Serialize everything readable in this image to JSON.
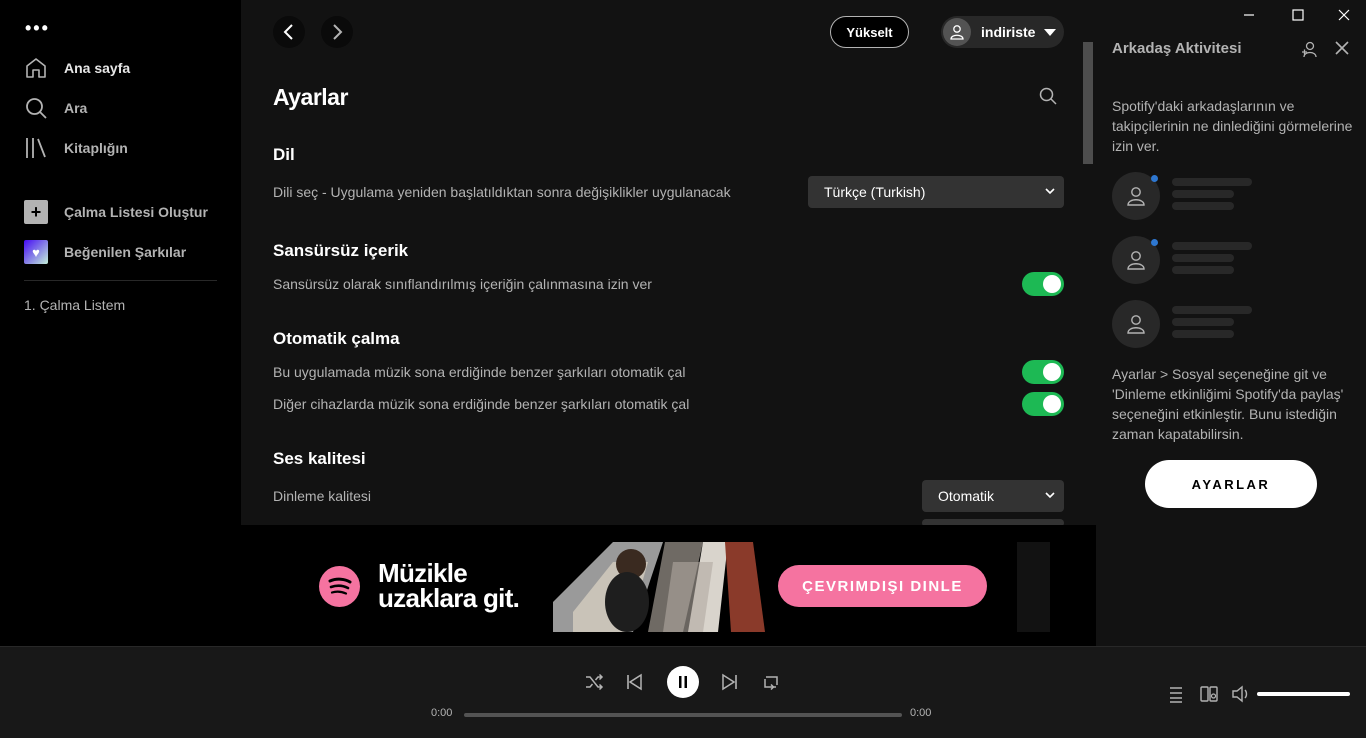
{
  "sidebar": {
    "menu_dots": "•••",
    "nav": [
      {
        "label": "Ana sayfa",
        "icon": "home-icon"
      },
      {
        "label": "Ara",
        "icon": "search-icon"
      },
      {
        "label": "Kitaplığın",
        "icon": "library-icon"
      }
    ],
    "create_playlist": "Çalma Listesi Oluştur",
    "liked_songs": "Beğenilen Şarkılar",
    "playlists": [
      "1. Çalma Listem"
    ]
  },
  "header": {
    "upgrade_label": "Yükselt",
    "user_name": "indiriste"
  },
  "settings": {
    "title": "Ayarlar",
    "language": {
      "section": "Dil",
      "label": "Dili seç - Uygulama yeniden başlatıldıktan sonra değişiklikler uygulanacak",
      "value": "Türkçe (Turkish)"
    },
    "explicit": {
      "section": "Sansürsüz içerik",
      "label": "Sansürsüz olarak sınıflandırılmış içeriğin çalınmasına izin ver",
      "enabled": true
    },
    "autoplay": {
      "section": "Otomatik çalma",
      "items": [
        {
          "label": "Bu uygulamada müzik sona erdiğinde benzer şarkıları otomatik çal",
          "enabled": true
        },
        {
          "label": "Diğer cihazlarda müzik sona erdiğinde benzer şarkıları otomatik çal",
          "enabled": true
        }
      ]
    },
    "audio_quality": {
      "section": "Ses kalitesi",
      "label": "Dinleme kalitesi",
      "value": "Otomatik"
    }
  },
  "ad": {
    "headline_line1": "Müzikle",
    "headline_line2": "uzaklara git.",
    "cta": "ÇEVRIMDIŞI DINLE",
    "brand_color": "#f573a0"
  },
  "friends": {
    "title": "Arkadaş Aktivitesi",
    "intro": "Spotify'daki arkadaşlarının ve takipçilerinin ne dinlediğini görmelerine izin ver.",
    "instructions": "Ayarlar > Sosyal seçeneğine git ve 'Dinleme etkinliğimi Spotify'da paylaş' seçeneğini etkinleştir. Bunu istediğin zaman kapatabilirsin.",
    "settings_button": "AYARLAR"
  },
  "player": {
    "time_elapsed": "0:00",
    "time_total": "0:00",
    "progress": 0,
    "volume": 1.0,
    "state": "playing"
  },
  "colors": {
    "accent_green": "#1db954",
    "online_dot": "#2e77d0"
  }
}
